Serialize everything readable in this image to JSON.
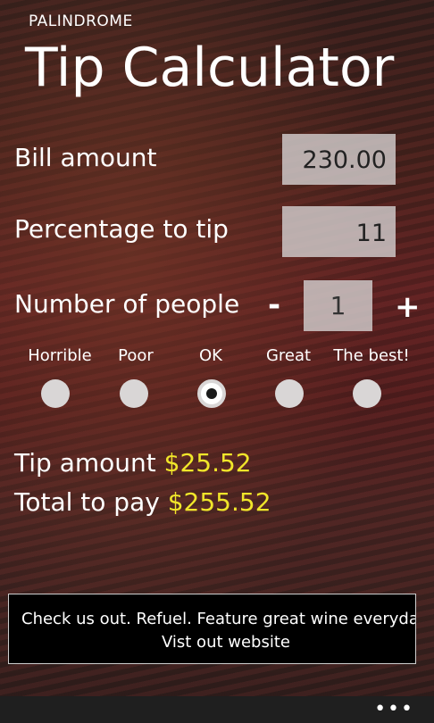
{
  "app": {
    "name": "PALINDROME",
    "title": "Tip Calculator"
  },
  "form": {
    "bill_label": "Bill amount",
    "bill_value": "230.00",
    "percent_label": "Percentage to tip",
    "percent_value": "11",
    "people_label": "Number of people",
    "people_minus": "-",
    "people_value": "1",
    "people_plus": "+"
  },
  "rating": {
    "options": [
      "Horrible",
      "Poor",
      "OK",
      "Great",
      "The best!"
    ],
    "selected": "OK"
  },
  "results": {
    "tip_label": "Tip amount",
    "tip_value": "$25.52",
    "total_label": "Total to pay",
    "total_value": "$255.52"
  },
  "ad": {
    "line1": "Check us out.  Refuel.  Feature great wine everyda",
    "line2": "Vist out website"
  },
  "app_bar": {
    "more": "•••"
  },
  "colors": {
    "accent": "#f0e62a"
  }
}
